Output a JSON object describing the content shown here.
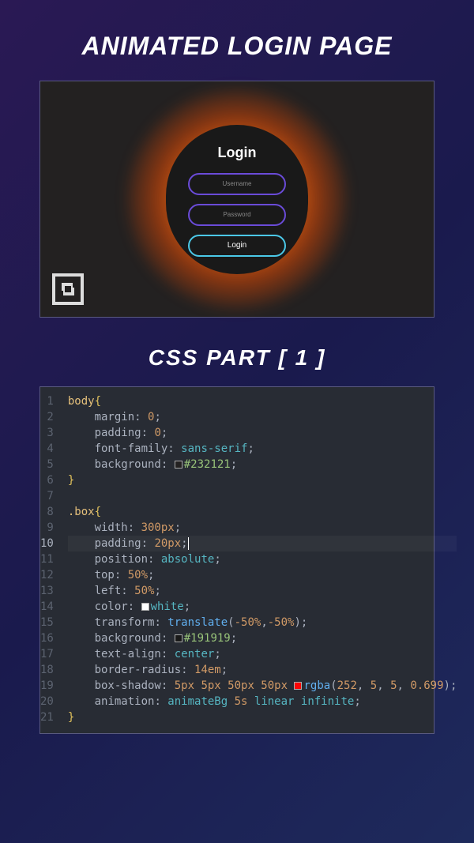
{
  "titles": {
    "main": "ANIMATED LOGIN PAGE",
    "section": "CSS PART [ 1 ]"
  },
  "preview": {
    "login_title": "Login",
    "username_placeholder": "Username",
    "password_placeholder": "Password",
    "button_label": "Login"
  },
  "code": {
    "lines": [
      {
        "n": "1",
        "segs": [
          [
            "sel",
            "body"
          ],
          [
            "brace",
            "{"
          ]
        ]
      },
      {
        "n": "2",
        "segs": [
          [
            "prop",
            "    margin"
          ],
          [
            "punc",
            ": "
          ],
          [
            "num",
            "0"
          ],
          [
            "semi",
            ";"
          ]
        ]
      },
      {
        "n": "3",
        "segs": [
          [
            "prop",
            "    padding"
          ],
          [
            "punc",
            ": "
          ],
          [
            "num",
            "0"
          ],
          [
            "semi",
            ";"
          ]
        ]
      },
      {
        "n": "4",
        "segs": [
          [
            "prop",
            "    font-family"
          ],
          [
            "punc",
            ": "
          ],
          [
            "kw",
            "sans-serif"
          ],
          [
            "semi",
            ";"
          ]
        ]
      },
      {
        "n": "5",
        "segs": [
          [
            "prop",
            "    background"
          ],
          [
            "punc",
            ": "
          ],
          [
            "swatch",
            "#232121"
          ],
          [
            "str",
            "#232121"
          ],
          [
            "semi",
            ";"
          ]
        ]
      },
      {
        "n": "6",
        "segs": [
          [
            "brace",
            "}"
          ]
        ]
      },
      {
        "n": "7",
        "segs": []
      },
      {
        "n": "8",
        "segs": [
          [
            "sel",
            ".box"
          ],
          [
            "brace",
            "{"
          ]
        ]
      },
      {
        "n": "9",
        "segs": [
          [
            "prop",
            "    width"
          ],
          [
            "punc",
            ": "
          ],
          [
            "num",
            "300px"
          ],
          [
            "semi",
            ";"
          ]
        ]
      },
      {
        "n": "10",
        "active": true,
        "segs": [
          [
            "prop",
            "    padding"
          ],
          [
            "punc",
            ": "
          ],
          [
            "num",
            "20px"
          ],
          [
            "semi",
            ";"
          ],
          [
            "cursor",
            ""
          ]
        ]
      },
      {
        "n": "11",
        "segs": [
          [
            "prop",
            "    position"
          ],
          [
            "punc",
            ": "
          ],
          [
            "kw",
            "absolute"
          ],
          [
            "semi",
            ";"
          ]
        ]
      },
      {
        "n": "12",
        "segs": [
          [
            "prop",
            "    top"
          ],
          [
            "punc",
            ": "
          ],
          [
            "num",
            "50%"
          ],
          [
            "semi",
            ";"
          ]
        ]
      },
      {
        "n": "13",
        "segs": [
          [
            "prop",
            "    left"
          ],
          [
            "punc",
            ": "
          ],
          [
            "num",
            "50%"
          ],
          [
            "semi",
            ";"
          ]
        ]
      },
      {
        "n": "14",
        "segs": [
          [
            "prop",
            "    color"
          ],
          [
            "punc",
            ": "
          ],
          [
            "swatch",
            "#ffffff"
          ],
          [
            "kw",
            "white"
          ],
          [
            "semi",
            ";"
          ]
        ]
      },
      {
        "n": "15",
        "segs": [
          [
            "prop",
            "    transform"
          ],
          [
            "punc",
            ": "
          ],
          [
            "fn",
            "translate"
          ],
          [
            "punc",
            "("
          ],
          [
            "num",
            "-50%"
          ],
          [
            "punc",
            ","
          ],
          [
            "num",
            "-50%"
          ],
          [
            "punc",
            ")"
          ],
          [
            "semi",
            ";"
          ]
        ]
      },
      {
        "n": "16",
        "segs": [
          [
            "prop",
            "    background"
          ],
          [
            "punc",
            ": "
          ],
          [
            "swatch",
            "#191919"
          ],
          [
            "str",
            "#191919"
          ],
          [
            "semi",
            ";"
          ]
        ]
      },
      {
        "n": "17",
        "segs": [
          [
            "prop",
            "    text-align"
          ],
          [
            "punc",
            ": "
          ],
          [
            "kw",
            "center"
          ],
          [
            "semi",
            ";"
          ]
        ]
      },
      {
        "n": "18",
        "segs": [
          [
            "prop",
            "    border-radius"
          ],
          [
            "punc",
            ": "
          ],
          [
            "num",
            "14em"
          ],
          [
            "semi",
            ";"
          ]
        ]
      },
      {
        "n": "19",
        "segs": [
          [
            "prop",
            "    box-shadow"
          ],
          [
            "punc",
            ": "
          ],
          [
            "num",
            "5px 5px 50px 50px"
          ],
          [
            "punc",
            " "
          ],
          [
            "swatch",
            "#fc0505"
          ],
          [
            "fn",
            "rgba"
          ],
          [
            "punc",
            "("
          ],
          [
            "num",
            "252"
          ],
          [
            "punc",
            ", "
          ],
          [
            "num",
            "5"
          ],
          [
            "punc",
            ", "
          ],
          [
            "num",
            "5"
          ],
          [
            "punc",
            ", "
          ],
          [
            "num",
            "0.699"
          ],
          [
            "punc",
            ")"
          ],
          [
            "semi",
            ";"
          ]
        ]
      },
      {
        "n": "20",
        "segs": [
          [
            "prop",
            "    animation"
          ],
          [
            "punc",
            ": "
          ],
          [
            "kw",
            "animateBg"
          ],
          [
            "punc",
            " "
          ],
          [
            "num",
            "5s"
          ],
          [
            "punc",
            " "
          ],
          [
            "kw",
            "linear infinite"
          ],
          [
            "semi",
            ";"
          ]
        ]
      },
      {
        "n": "21",
        "segs": [
          [
            "brace",
            "}"
          ]
        ]
      }
    ]
  }
}
